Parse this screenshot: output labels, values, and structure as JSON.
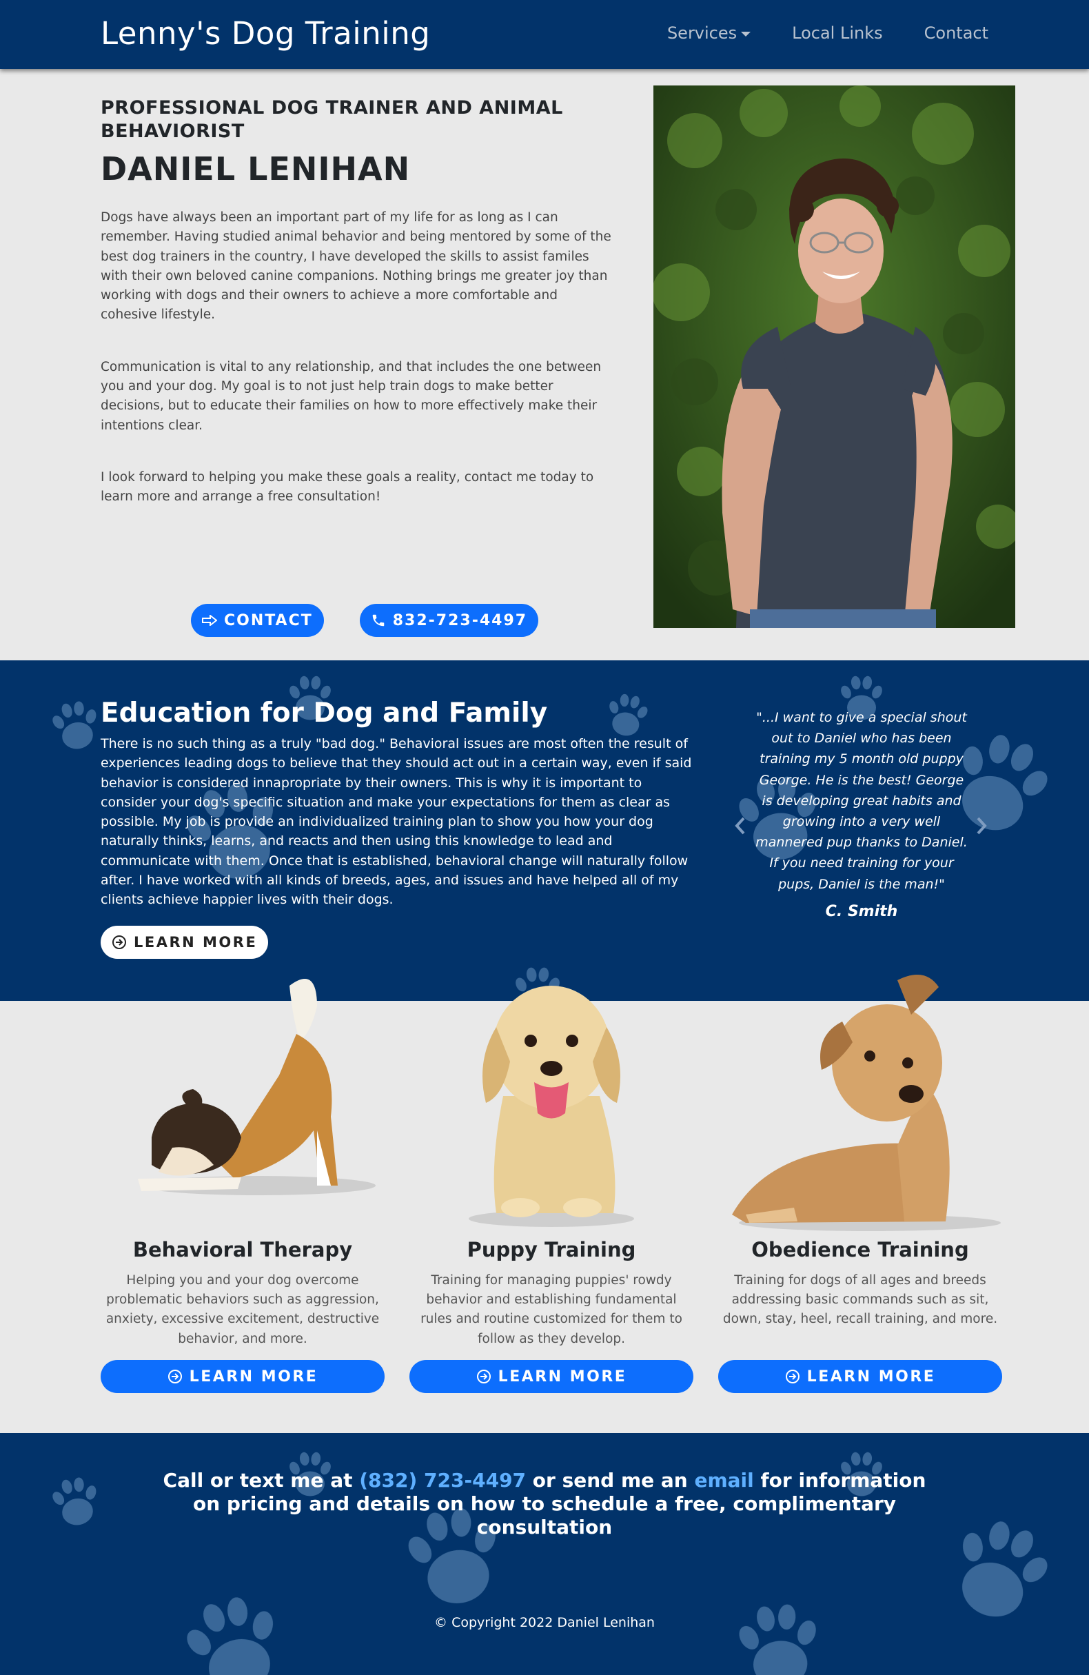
{
  "nav": {
    "brand": "Lenny's Dog Training",
    "links": [
      "Services",
      "Local Links",
      "Contact"
    ]
  },
  "about": {
    "subtitle": "PROFESSIONAL DOG TRAINER AND ANIMAL BEHAVIORIST",
    "name": "DANIEL LENIHAN",
    "paragraphs": [
      "Dogs have always been an important part of my life for as long as I can remember. Having studied animal behavior and being mentored by some of the best dog trainers in the country, I have developed the skills to assist familes with their own beloved canine companions. Nothing brings me greater joy than working with dogs and their owners to achieve a more comfortable and cohesive lifestyle.",
      "Communication is vital to any relationship, and that includes the one between you and your dog. My goal is to not just help train dogs to make better decisions, but to educate their families on how to more effectively make their intentions clear.",
      "I look forward to helping you make these goals a reality, contact me today to learn more and arrange a free consultation!"
    ],
    "contact_label": "CONTACT",
    "phone_label": "832-723-4497"
  },
  "education": {
    "title": "Education for Dog and Family",
    "paragraph": "There is no such thing as a truly \"bad dog.\" Behavioral issues are most often the result of experiences leading dogs to believe that they should act out in a certain way, even if said behavior is considered innapropriate by their owners. This is why it is important to consider your dog's specific situation and make your expectations for them as clear as possible. My job is provide an individualized training plan to show you how your dog naturally thinks, learns, and reacts and then using this knowledge to lead and communicate with them. Once that is established, behavioral change will naturally follow after. I have worked with all kinds of breeds, ages, and issues and have helped all of my clients achieve happier lives with their dogs.",
    "learn_more": "LEARN MORE",
    "testimonial": {
      "quote": "\"...I want to give a special shout out to Daniel who has been training my 5 month old puppy George. He is the best! George is developing great habits and growing into a very well mannered pup thanks to Daniel. If you need training for your pups, Daniel is the man!\"",
      "author": "C. Smith"
    }
  },
  "services": [
    {
      "title": "Behavioral Therapy",
      "description": "Helping you and your dog overcome problematic behaviors such as aggression, anxiety, excessive excitement, destructive behavior, and more.",
      "button": "LEARN MORE"
    },
    {
      "title": "Puppy Training",
      "description": "Training for managing puppies' rowdy behavior and establishing fundamental rules and routine customized for them to follow as they develop.",
      "button": "LEARN MORE"
    },
    {
      "title": "Obedience Training",
      "description": "Training for dogs of all ages and breeds addressing basic commands such as sit, down, stay, heel, recall training, and more.",
      "button": "LEARN MORE"
    }
  ],
  "footer": {
    "cta_pre": "Call or text me at ",
    "cta_phone": "(832) 723-4497",
    "cta_mid": " or send me an ",
    "cta_email": "email",
    "cta_post": " for information on pricing and details on how to schedule a free, complimentary consultation",
    "copyright": "© Copyright 2022 Daniel Lenihan"
  },
  "colors": {
    "navy": "#02336a",
    "primary_blue": "#0d6efd",
    "link_blue": "#5fb0ff",
    "page_bg": "#e9e9e9"
  }
}
